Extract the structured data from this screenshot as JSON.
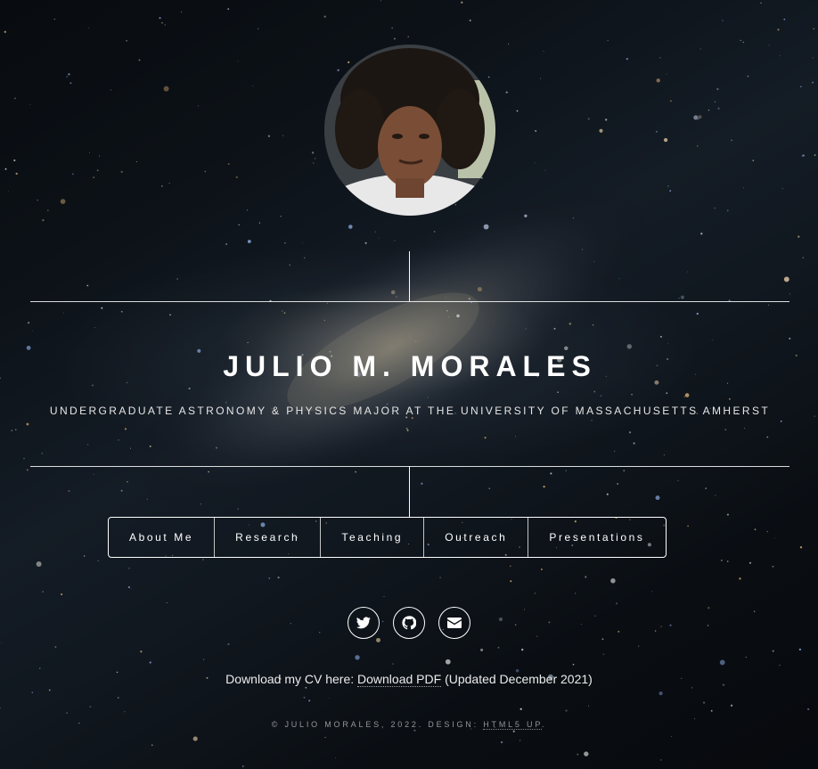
{
  "header": {
    "name": "Julio M. Morales",
    "tagline": "Undergraduate Astronomy & Physics Major at the University of Massachusetts Amherst"
  },
  "nav": {
    "items": [
      {
        "label": "About Me"
      },
      {
        "label": "Research"
      },
      {
        "label": "Teaching"
      },
      {
        "label": "Outreach"
      },
      {
        "label": "Presentations"
      }
    ]
  },
  "social": {
    "icons": [
      "twitter-icon",
      "github-icon",
      "envelope-icon"
    ]
  },
  "cv": {
    "prefix": "Download my CV here:",
    "link_label": "Download PDF",
    "suffix": "(Updated December 2021)"
  },
  "footer": {
    "copyright": "© Julio Morales, 2022. Design:",
    "design_link": "HTML5 UP"
  },
  "colors": {
    "text": "#ffffff",
    "background": "#0d1218"
  }
}
